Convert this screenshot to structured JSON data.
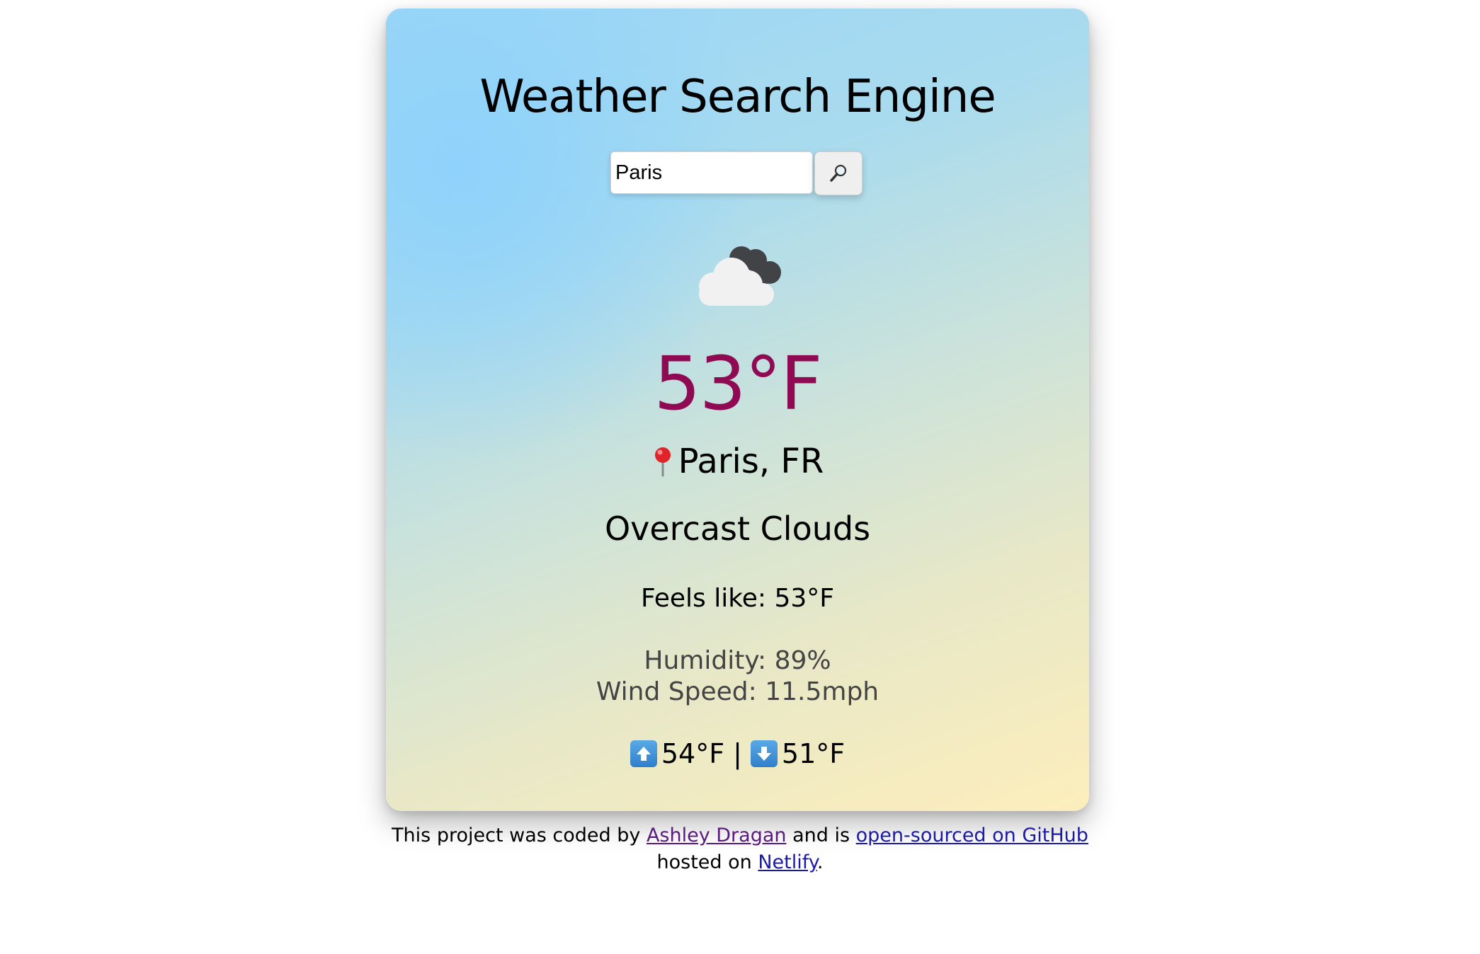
{
  "app": {
    "title": "Weather Search Engine"
  },
  "search": {
    "value": "Paris",
    "button_icon": "magnifying-glass-icon"
  },
  "current": {
    "icon": "overcast-clouds-icon",
    "temperature": "53°F",
    "location": "Paris, FR",
    "location_icon": "map-pin-icon",
    "description": "Overcast Clouds",
    "feels_like": "Feels like: 53°F",
    "humidity": "Humidity: 89%",
    "wind": "Wind Speed: 11.5mph",
    "high": "54°F",
    "separator": "|",
    "low": "51°F",
    "high_icon": "up-arrow-icon",
    "low_icon": "down-arrow-icon"
  },
  "footer": {
    "text1": "This project was coded by",
    "author": "Ashley Dragan",
    "text2": "and is",
    "github": "open-sourced on GitHub",
    "text3": "hosted on",
    "netlify": "Netlify",
    "text4": "."
  },
  "colors": {
    "temperature": "#8f0a52",
    "link": "#1a1aa6",
    "visited_link": "#5a1a7e"
  }
}
